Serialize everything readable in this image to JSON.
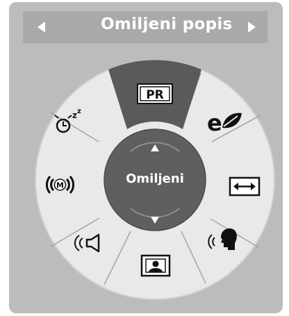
{
  "header": {
    "title": "Omiljeni popis",
    "prev_icon": "triangle-left-icon",
    "next_icon": "triangle-right-icon"
  },
  "center": {
    "label": "Omiljeni",
    "up_icon": "triangle-up-icon",
    "down_icon": "triangle-down-icon"
  },
  "menu_items": [
    {
      "id": "pr",
      "icon": "pr-icon",
      "label": "PR",
      "selected": true
    },
    {
      "id": "eco",
      "icon": "eco-leaf-icon",
      "selected": false
    },
    {
      "id": "aspect",
      "icon": "aspect-ratio-icon",
      "selected": false
    },
    {
      "id": "clear-voice",
      "icon": "clear-voice-icon",
      "selected": false
    },
    {
      "id": "picture",
      "icon": "picture-mode-icon",
      "selected": false
    },
    {
      "id": "sound",
      "icon": "sound-mode-icon",
      "selected": false
    },
    {
      "id": "mode",
      "icon": "mode-m-icon",
      "label": "M",
      "selected": false
    },
    {
      "id": "sleep",
      "icon": "sleep-timer-icon",
      "label": "zz",
      "selected": false
    }
  ],
  "colors": {
    "panel": "#bcbcbc",
    "titlebar": "#a9a9a9",
    "dial": "#e9e9e9",
    "selected_segment": "#5a5a5a",
    "center_disc": "#5f5f5f",
    "icon": "#111111"
  }
}
